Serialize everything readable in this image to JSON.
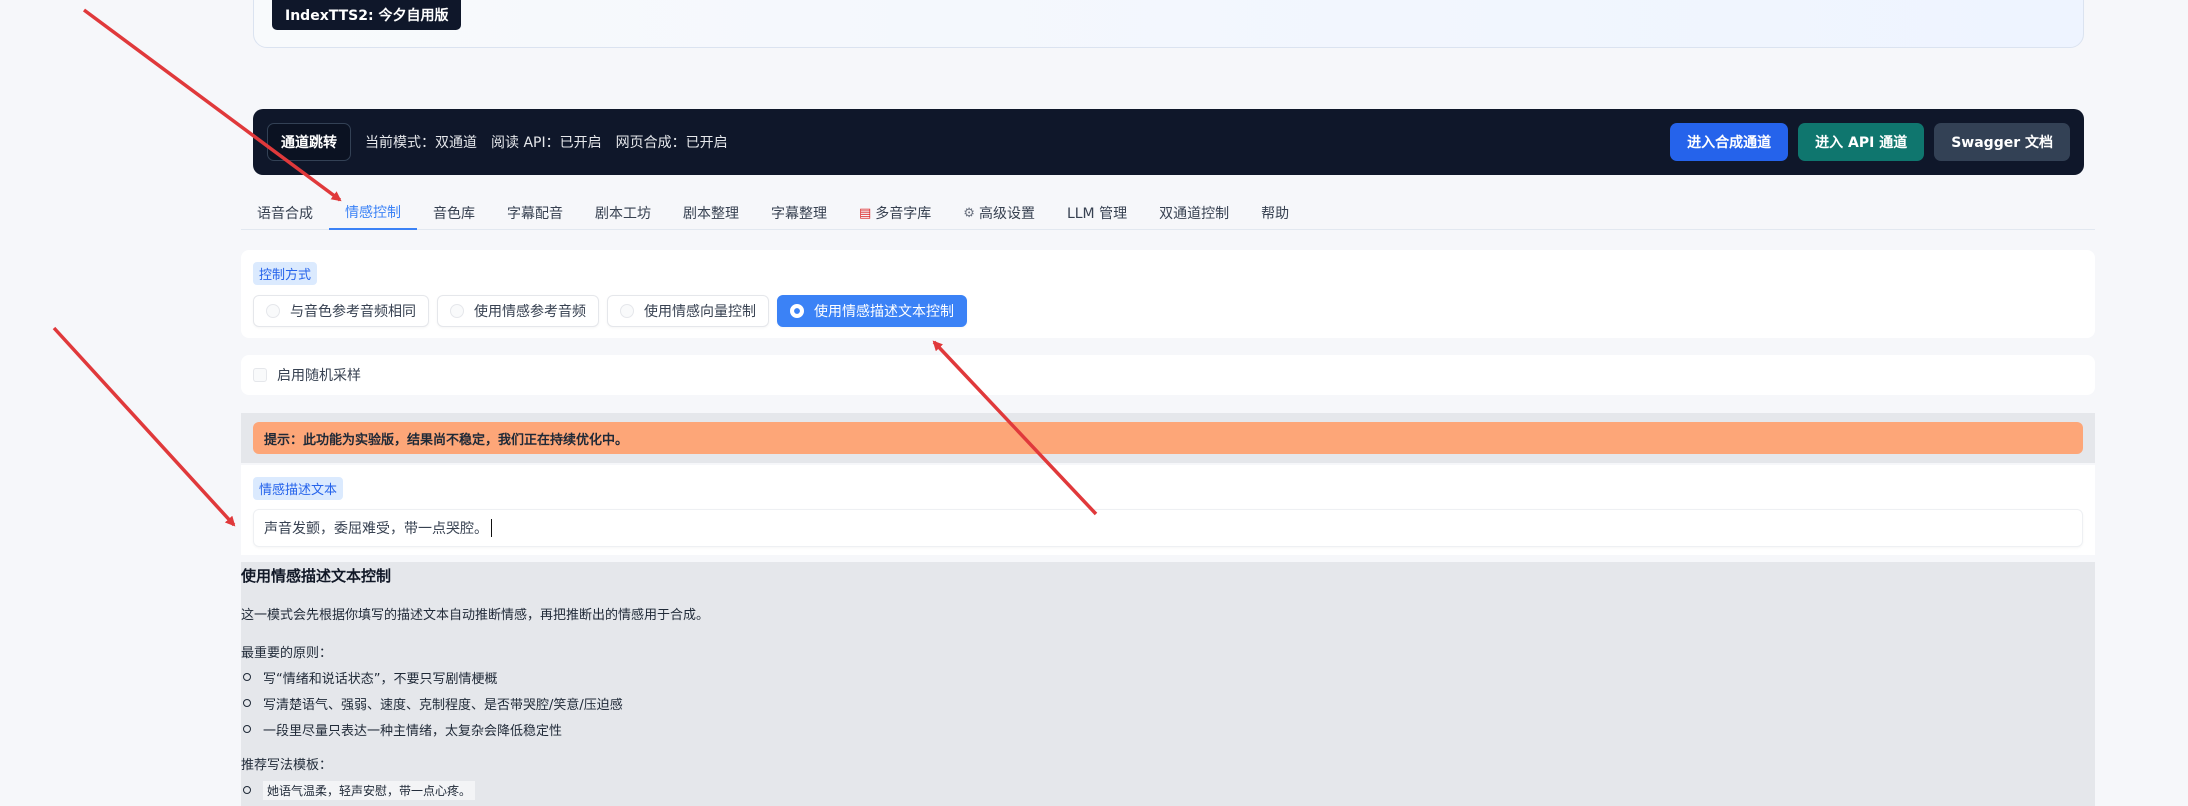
{
  "top": {
    "badge": "IndexTTS2: 今夕自用版"
  },
  "navbar": {
    "jump_label": "通道跳转",
    "mode": "当前模式：双通道",
    "read_api": "阅读 API：已开启",
    "web_synth": "网页合成：已开启",
    "btn_synth": "进入合成通道",
    "btn_api": "进入 API 通道",
    "btn_swagger": "Swagger 文档"
  },
  "tabs": [
    {
      "label": "语音合成"
    },
    {
      "label": "情感控制"
    },
    {
      "label": "音色库"
    },
    {
      "label": "字幕配音"
    },
    {
      "label": "剧本工坊"
    },
    {
      "label": "剧本整理"
    },
    {
      "label": "字幕整理"
    },
    {
      "label": "多音字库",
      "icon": "book-icon"
    },
    {
      "label": "高级设置",
      "icon": "gear-icon"
    },
    {
      "label": "LLM 管理"
    },
    {
      "label": "双通道控制"
    },
    {
      "label": "帮助"
    }
  ],
  "control": {
    "label": "控制方式",
    "options": [
      "与音色参考音频相同",
      "使用情感参考音频",
      "使用情感向量控制",
      "使用情感描述文本控制"
    ],
    "selected_index": 3
  },
  "random": {
    "label": "启用随机采样",
    "checked": false
  },
  "warning": "提示：此功能为实验版，结果尚不稳定，我们正在持续优化中。",
  "desc": {
    "label": "情感描述文本",
    "value": "声音发颤，委屈难受，带一点哭腔。"
  },
  "help": {
    "title": "使用情感描述文本控制",
    "intro": "这一模式会先根据你填写的描述文本自动推断情感，再把推断出的情感用于合成。",
    "principles_title": "最重要的原则：",
    "principles": [
      "写“情绪和说话状态”，不要只写剧情梗概",
      "写清楚语气、强弱、速度、克制程度、是否带哭腔/笑意/压迫感",
      "一段里尽量只表达一种主情绪，太复杂会降低稳定性"
    ],
    "template_title": "推荐写法模板：",
    "templates": [
      "她语气温柔，轻声安慰，带一点心疼。"
    ]
  },
  "colors": {
    "accent": "#3b82f6",
    "navbar": "#0f172a",
    "warning": "#fda678",
    "arrow": "#e0393b"
  }
}
